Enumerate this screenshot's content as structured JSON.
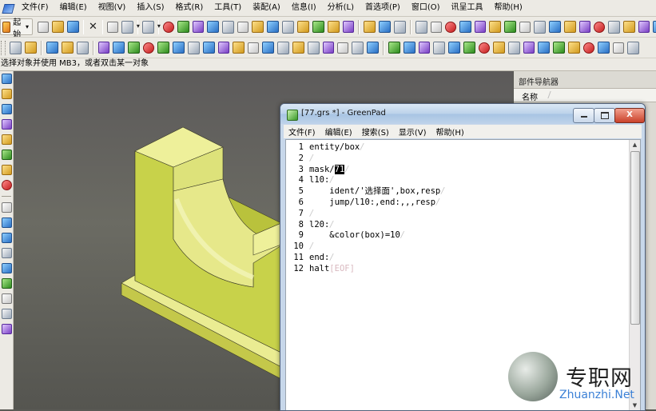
{
  "menubar": {
    "items": [
      "文件(F)",
      "编辑(E)",
      "视图(V)",
      "插入(S)",
      "格式(R)",
      "工具(T)",
      "装配(A)",
      "信息(I)",
      "分析(L)",
      "首选项(P)",
      "窗口(O)",
      "讯呈工具",
      "帮助(H)"
    ]
  },
  "toolbar": {
    "start_label": "起始"
  },
  "statusline": {
    "text": "选择对象并使用 MB3，或者双击某一对象"
  },
  "navigator": {
    "title": "部件导航器",
    "column_name": "名称"
  },
  "greenpad": {
    "title": "[77.grs *] - GreenPad",
    "close_glyph": "X",
    "menus": [
      "文件(F)",
      "编辑(E)",
      "搜索(S)",
      "显示(V)",
      "帮助(H)"
    ],
    "newline_mark": "/",
    "eof_mark": "[EOF]",
    "lines": [
      {
        "n": "1",
        "before": "entity/box",
        "sel": "",
        "after": ""
      },
      {
        "n": "2",
        "before": "",
        "sel": "",
        "after": ""
      },
      {
        "n": "3",
        "before": "mask/",
        "sel": "71",
        "after": ""
      },
      {
        "n": "4",
        "before": "l10:",
        "sel": "",
        "after": ""
      },
      {
        "n": "5",
        "before": "    ident/'选择面',box,resp",
        "sel": "",
        "after": ""
      },
      {
        "n": "6",
        "before": "    jump/l10:,end:,,,resp",
        "sel": "",
        "after": ""
      },
      {
        "n": "7",
        "before": "",
        "sel": "",
        "after": ""
      },
      {
        "n": "8",
        "before": "l20:",
        "sel": "",
        "after": ""
      },
      {
        "n": "9",
        "before": "    &color(box)=10",
        "sel": "",
        "after": ""
      },
      {
        "n": "10",
        "before": "",
        "sel": "",
        "after": ""
      },
      {
        "n": "11",
        "before": "end:",
        "sel": "",
        "after": ""
      },
      {
        "n": "12",
        "before": "halt",
        "sel": "",
        "after": "",
        "eof": true
      }
    ]
  },
  "watermark": {
    "name": "专职网",
    "url": "Zhuanzhi.Net"
  },
  "colors": {
    "model_face": "#e6e88a",
    "viewport_bg": "#5c5a5a"
  }
}
